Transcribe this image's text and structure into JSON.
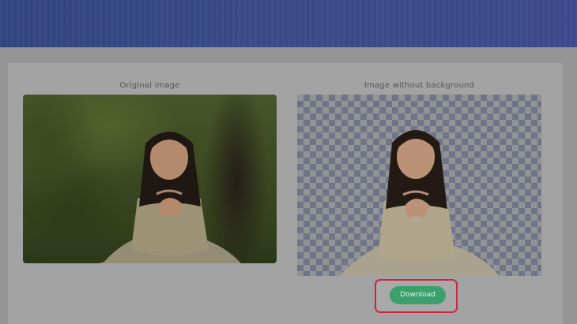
{
  "panels": {
    "original": {
      "label": "Original image"
    },
    "result": {
      "label": "Image without background"
    }
  },
  "actions": {
    "download_label": "Download"
  },
  "colors": {
    "header": "#394c87",
    "download_button": "#3ba06c",
    "highlight_border": "#d0263a",
    "transparency_checker": "#5b6580"
  },
  "icons": {
    "transparency_pattern": "checkerboard"
  }
}
